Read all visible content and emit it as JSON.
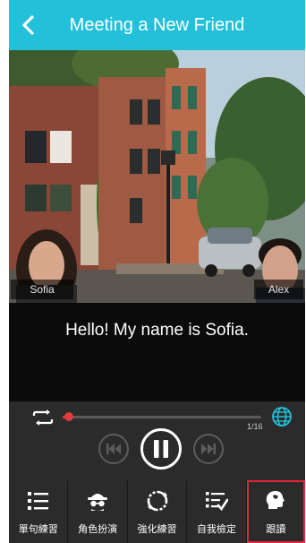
{
  "header": {
    "title": "Meeting a New Friend",
    "back_icon": "chevron-left-icon"
  },
  "scene": {
    "characters": [
      {
        "name": "Sofia",
        "position": "left"
      },
      {
        "name": "Alex",
        "position": "right"
      }
    ]
  },
  "subtitle": {
    "text": "Hello! My name is Sofia."
  },
  "player": {
    "page_counter": "1/16",
    "progress": 0.03,
    "icons": [
      "repeat-icon",
      "globe-icon",
      "skip-previous-icon",
      "pause-icon",
      "skip-next-icon"
    ]
  },
  "tabs": [
    {
      "label": "單句練習",
      "icon": "list-icon",
      "active": false
    },
    {
      "label": "角色扮演",
      "icon": "spy-icon",
      "active": false
    },
    {
      "label": "強化練習",
      "icon": "cycle-icon",
      "active": false
    },
    {
      "label": "自我檢定",
      "icon": "checklist-icon",
      "active": false
    },
    {
      "label": "跟讀",
      "icon": "speaking-head-icon",
      "active": true
    }
  ],
  "colors": {
    "header": "#22c0d9",
    "accent": "#e23b3b",
    "globe": "#22c0d9",
    "active_outline": "#e0283a"
  }
}
